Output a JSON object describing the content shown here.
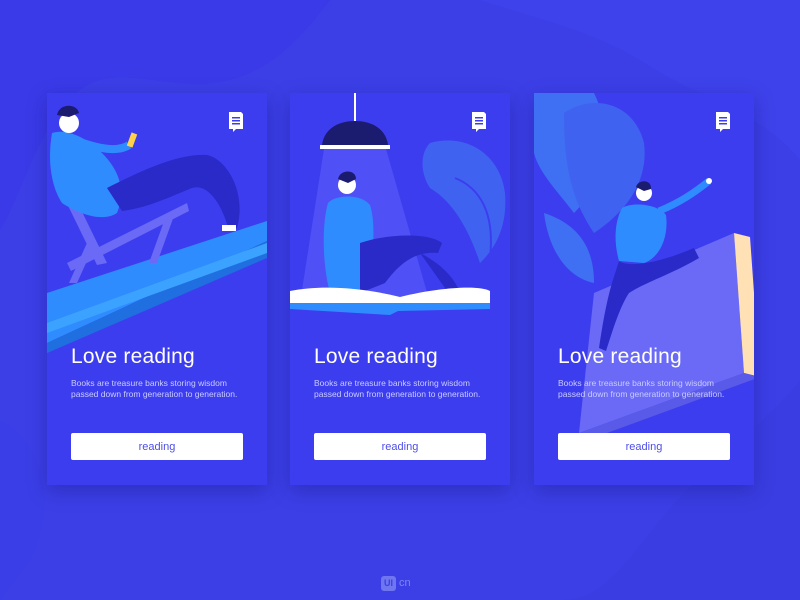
{
  "cards": [
    {
      "title": "Love reading",
      "description_line1": "Books are treasure banks storing wisdom",
      "description_line2": "passed down from generation to generation.",
      "button_label": "reading"
    },
    {
      "title": "Love reading",
      "description_line1": "Books are treasure banks storing wisdom",
      "description_line2": "passed down from generation to generation.",
      "button_label": "reading"
    },
    {
      "title": "Love reading",
      "description_line1": "Books are treasure banks storing wisdom",
      "description_line2": "passed down from generation to generation.",
      "button_label": "reading"
    }
  ],
  "watermark": {
    "mark": "UI",
    "text": "cn"
  },
  "icons": [
    "book-icon",
    "lamp-icon",
    "leaf-icon"
  ],
  "colors": {
    "background": "#3c3fe6",
    "card": "#3d3df0",
    "button": "#ffffff",
    "button_text": "#4e4ee8",
    "accent_light_blue": "#2f8cff"
  }
}
